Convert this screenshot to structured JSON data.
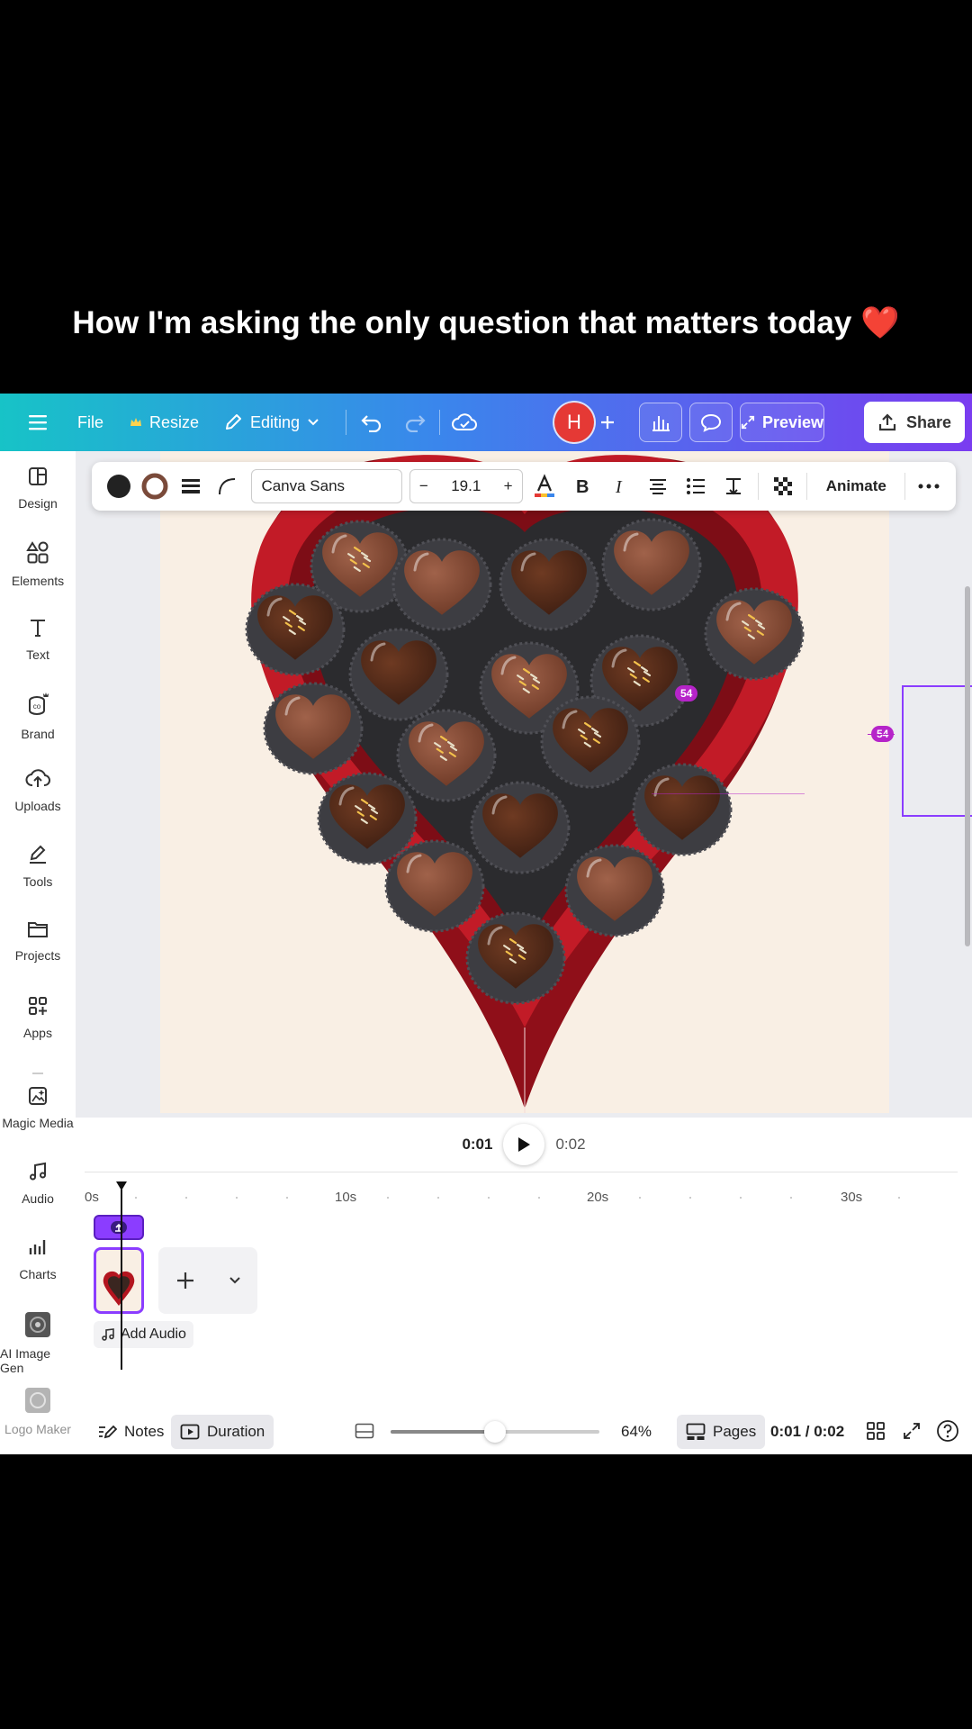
{
  "caption": {
    "text": "How I'm asking the only question that matters today",
    "emoji": "❤️"
  },
  "topbar": {
    "file": "File",
    "resize": "Resize",
    "editing": "Editing",
    "avatar_initial": "H",
    "preview": "Preview",
    "share": "Share"
  },
  "sidebar": {
    "items": [
      {
        "label": "Design",
        "icon": "design-icon"
      },
      {
        "label": "Elements",
        "icon": "elements-icon"
      },
      {
        "label": "Text",
        "icon": "text-icon"
      },
      {
        "label": "Brand",
        "icon": "brand-icon"
      },
      {
        "label": "Uploads",
        "icon": "uploads-icon"
      },
      {
        "label": "Tools",
        "icon": "tools-icon"
      },
      {
        "label": "Projects",
        "icon": "projects-icon"
      },
      {
        "label": "Apps",
        "icon": "apps-icon"
      },
      {
        "label": "Magic Media",
        "icon": "magic-media-icon"
      },
      {
        "label": "Audio",
        "icon": "audio-icon"
      },
      {
        "label": "Charts",
        "icon": "charts-icon"
      },
      {
        "label": "AI Image Gen",
        "icon": "ai-image-gen-icon"
      },
      {
        "label": "Logo Maker",
        "icon": "logo-maker-icon"
      }
    ]
  },
  "toolbar": {
    "font": "Canva Sans",
    "size": "19.1",
    "minus": "−",
    "plus": "+",
    "animate": "Animate"
  },
  "canvas": {
    "guide_badge_1": "54",
    "guide_badge_2": "54"
  },
  "timeline": {
    "current_time": "0:01",
    "total_time": "0:02",
    "ruler": [
      "0s",
      "10s",
      "20s",
      "30s"
    ],
    "add_audio": "Add Audio"
  },
  "footer": {
    "notes": "Notes",
    "duration": "Duration",
    "zoom": "64%",
    "zoom_fraction": 0.5,
    "pages": "Pages",
    "time": "0:01 / 0:02"
  },
  "colors": {
    "accent": "#8b3dff",
    "box_red": "#b3151f",
    "chocolate": "#5b3020"
  }
}
